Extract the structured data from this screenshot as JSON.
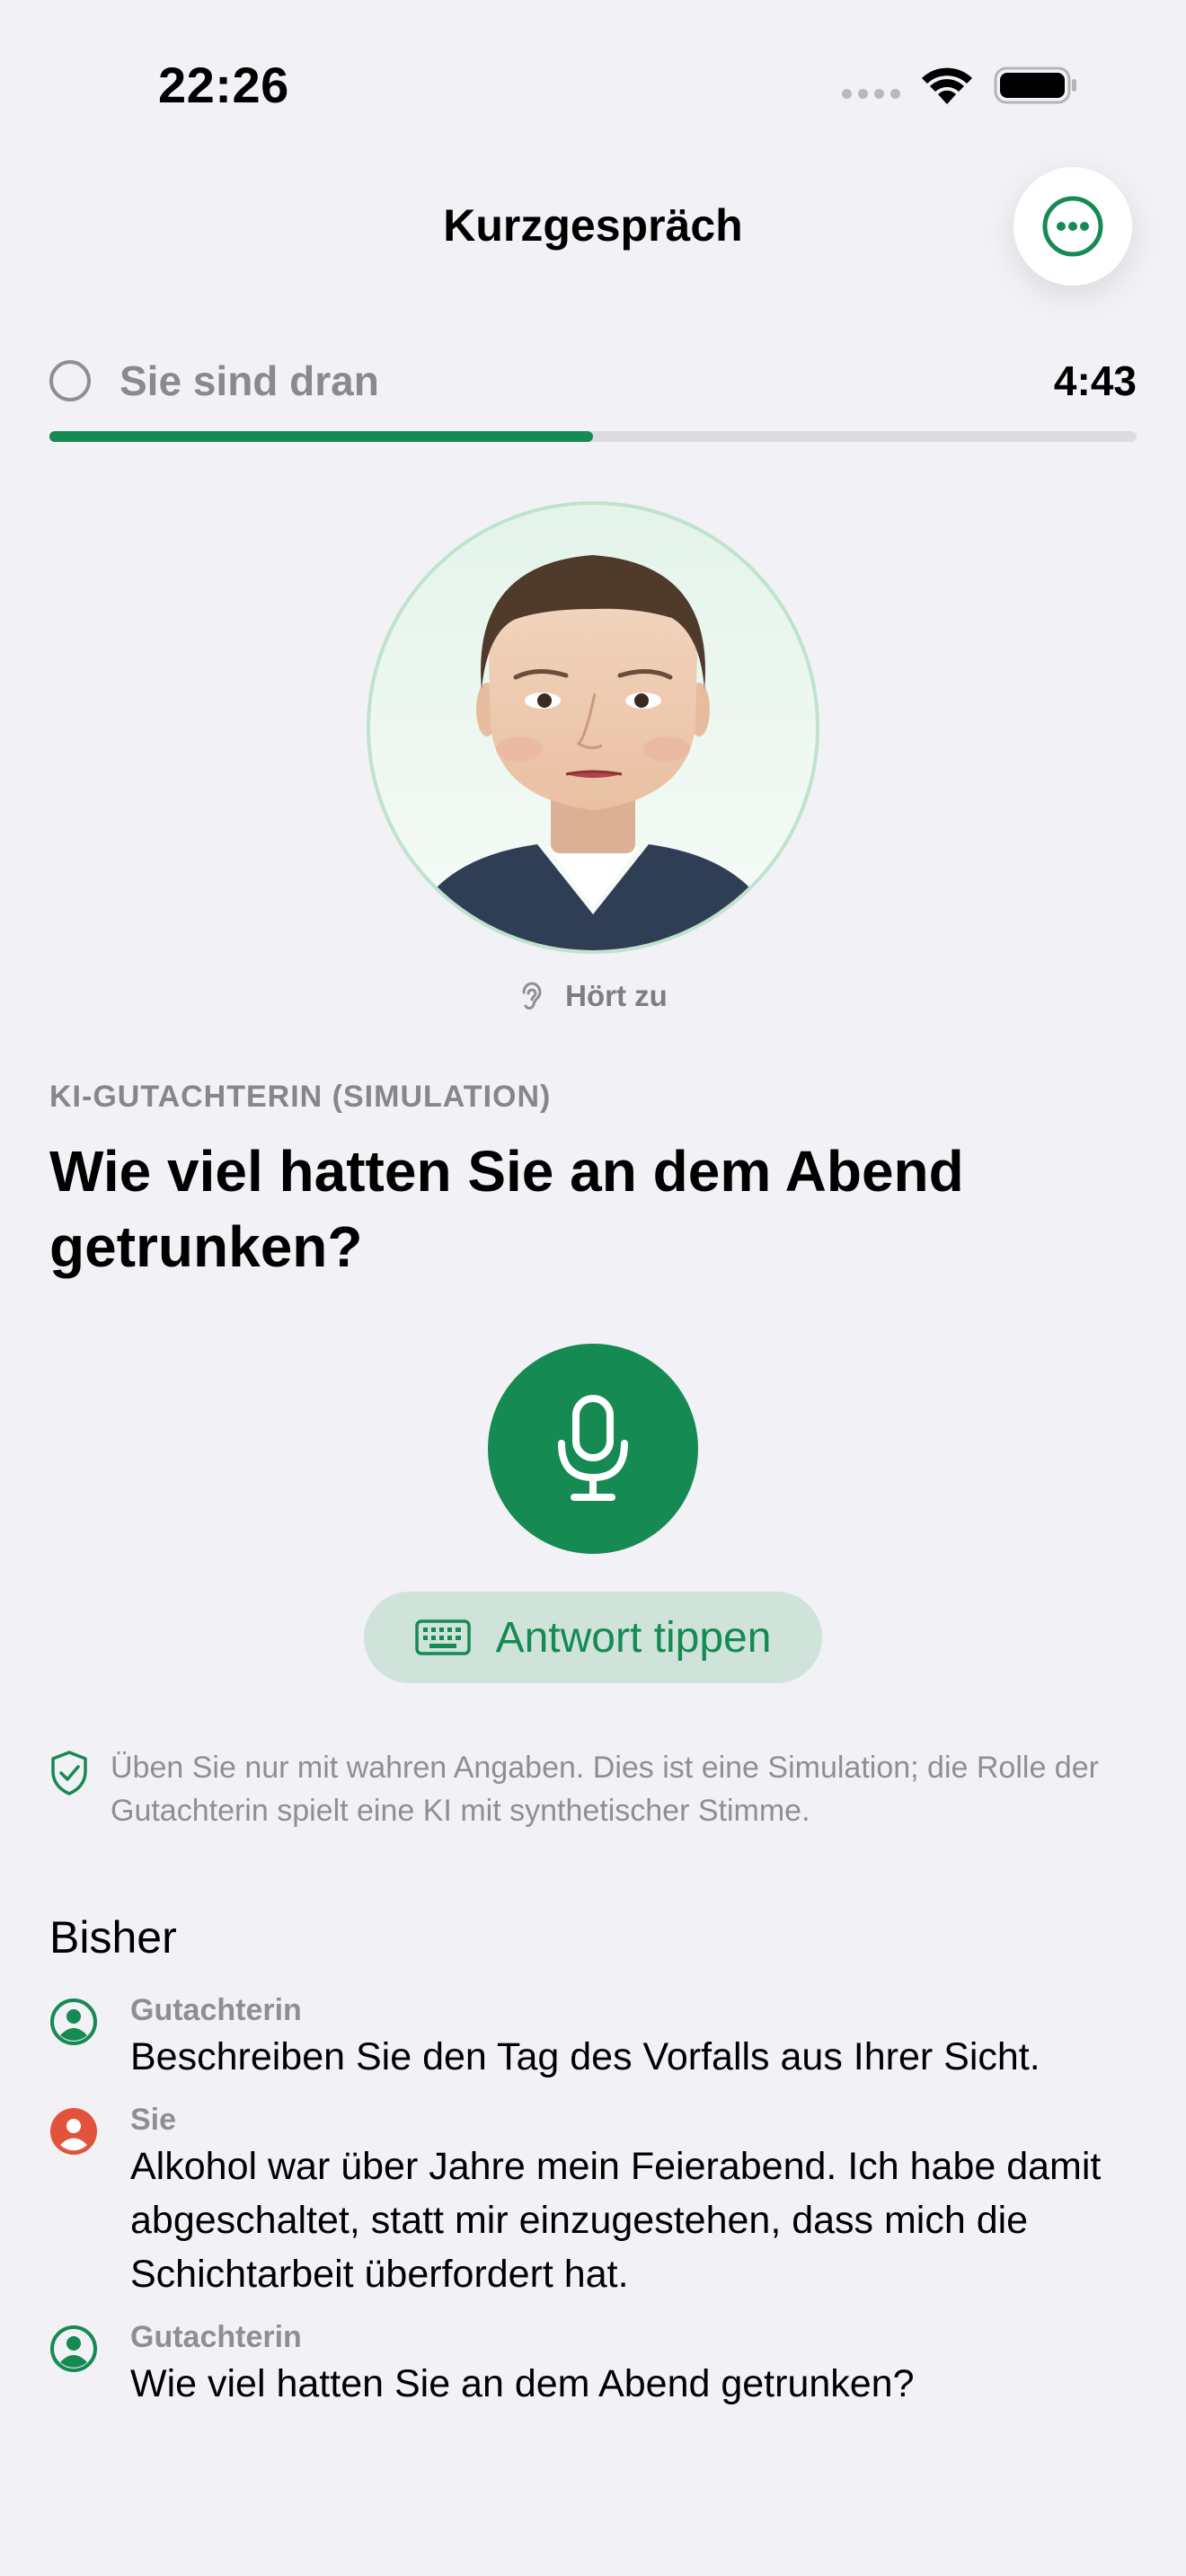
{
  "status_bar": {
    "time": "22:26"
  },
  "nav": {
    "title": "Kurzgespräch"
  },
  "turn": {
    "label": "Sie sind dran",
    "timer": "4:43",
    "progress": 0.5
  },
  "avatar": {
    "status": "Hört zu"
  },
  "question": {
    "role_caption": "KI-GUTACHTERIN (SIMULATION)",
    "text": "Wie viel hatten Sie an dem Abend getrunken?"
  },
  "actions": {
    "type_answer_label": "Antwort tippen"
  },
  "notice": "Üben Sie nur mit wahren Angaben. Dies ist eine Simulation; die Rolle der Gutachterin spielt eine KI mit synthetischer Stimme.",
  "history": {
    "title": "Bisher",
    "items": [
      {
        "speaker": "Gutachterin",
        "role": "examiner",
        "text": "Beschreiben Sie den Tag des Vorfalls aus Ihrer Sicht."
      },
      {
        "speaker": "Sie",
        "role": "user",
        "text": "Alkohol war über Jahre mein Feierabend. Ich habe damit abgeschaltet, statt mir einzugestehen, dass mich die Schichtarbeit überfordert hat."
      },
      {
        "speaker": "Gutachterin",
        "role": "examiner",
        "text": "Wie viel hatten Sie an dem Abend getrunken?"
      }
    ]
  },
  "colors": {
    "accent": "#158a52",
    "user": "#e2533b",
    "background": "#f2f1f6"
  }
}
